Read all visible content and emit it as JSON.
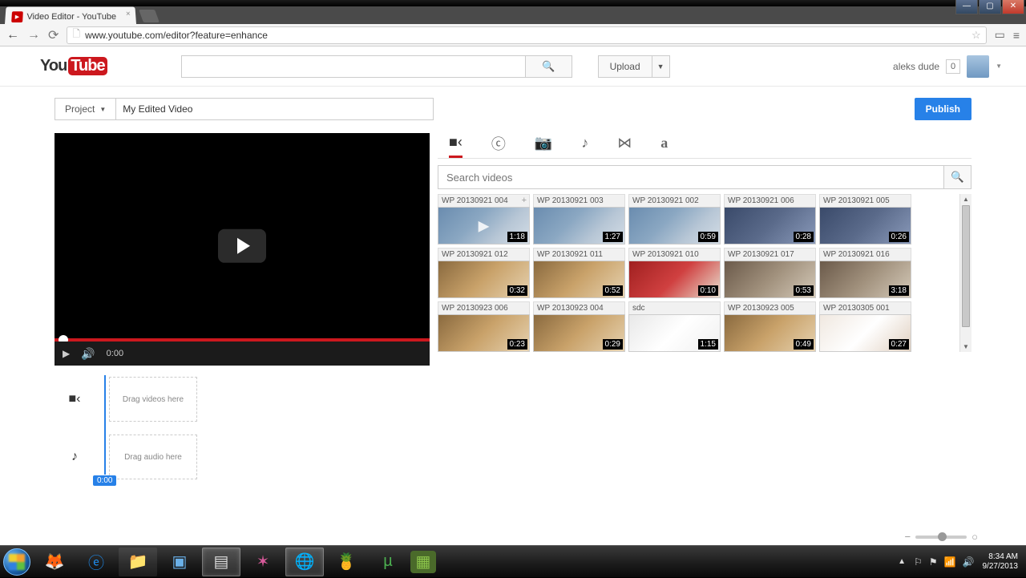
{
  "window": {
    "title": "Video Editor - YouTube"
  },
  "browser": {
    "url": "www.youtube.com/editor?feature=enhance"
  },
  "yt_header": {
    "logo_you": "You",
    "logo_tube": "Tube",
    "upload_label": "Upload",
    "user_name": "aleks dude",
    "notif_count": "0"
  },
  "editor": {
    "project_label": "Project",
    "project_name": "My Edited Video",
    "publish_label": "Publish"
  },
  "preview": {
    "time": "0:00"
  },
  "media": {
    "search_placeholder": "Search videos",
    "items": [
      {
        "title": "WP 20130921 004",
        "dur": "1:18",
        "cls": "",
        "hover": true
      },
      {
        "title": "WP 20130921 003",
        "dur": "1:27",
        "cls": ""
      },
      {
        "title": "WP 20130921 002",
        "dur": "0:59",
        "cls": ""
      },
      {
        "title": "WP 20130921 006",
        "dur": "0:28",
        "cls": "store"
      },
      {
        "title": "WP 20130921 005",
        "dur": "0:26",
        "cls": "store"
      },
      {
        "title": "WP 20130921 012",
        "dur": "0:32",
        "cls": "food"
      },
      {
        "title": "WP 20130921 011",
        "dur": "0:52",
        "cls": "food"
      },
      {
        "title": "WP 20130921 010",
        "dur": "0:10",
        "cls": "cup"
      },
      {
        "title": "WP 20130921 017",
        "dur": "0:53",
        "cls": "cat"
      },
      {
        "title": "WP 20130921 016",
        "dur": "3:18",
        "cls": "cat"
      },
      {
        "title": "WP 20130923 006",
        "dur": "0:23",
        "cls": "food"
      },
      {
        "title": "WP 20130923 004",
        "dur": "0:29",
        "cls": "food"
      },
      {
        "title": "sdc",
        "dur": "1:15",
        "cls": "white"
      },
      {
        "title": "WP 20130923 005",
        "dur": "0:49",
        "cls": "food"
      },
      {
        "title": "WP 20130305 001",
        "dur": "0:27",
        "cls": "plate"
      }
    ]
  },
  "timeline": {
    "drop_video": "Drag videos here",
    "drop_audio": "Drag audio here",
    "playhead_time": "0:00"
  },
  "taskbar": {
    "time": "8:34 AM",
    "date": "9/27/2013"
  }
}
